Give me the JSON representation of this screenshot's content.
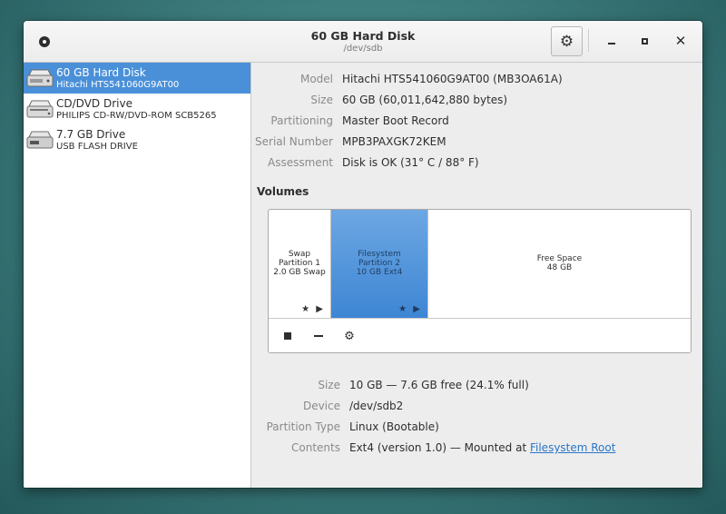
{
  "window": {
    "title": "60 GB Hard Disk",
    "subtitle": "/dev/sdb"
  },
  "titlebar_icons": {
    "menu": "app-menu-icon",
    "settings": "gear-icon",
    "minimize": "minimize-icon",
    "maximize": "maximize-icon",
    "close": "close-icon"
  },
  "sidebar": {
    "drives": [
      {
        "name": "60 GB Hard Disk",
        "detail": "Hitachi HTS541060G9AT00",
        "icon": "hard-disk-icon",
        "selected": true
      },
      {
        "name": "CD/DVD Drive",
        "detail": "PHILIPS CD-RW/DVD-ROM SCB5265",
        "icon": "optical-drive-icon",
        "selected": false
      },
      {
        "name": "7.7 GB Drive",
        "detail": "USB FLASH DRIVE",
        "icon": "usb-drive-icon",
        "selected": false
      }
    ]
  },
  "disk_properties": [
    {
      "label": "Model",
      "value": "Hitachi HTS541060G9AT00 (MB3OA61A)"
    },
    {
      "label": "Size",
      "value": "60 GB (60,011,642,880 bytes)"
    },
    {
      "label": "Partitioning",
      "value": "Master Boot Record"
    },
    {
      "label": "Serial Number",
      "value": "MPB3PAXGK72KEM"
    },
    {
      "label": "Assessment",
      "value": "Disk is OK (31° C / 88° F)"
    }
  ],
  "volumes": {
    "heading": "Volumes",
    "partitions": [
      {
        "line1": "Swap",
        "line2": "Partition 1",
        "line3": "2.0 GB Swap",
        "selected": false
      },
      {
        "line1": "Filesystem",
        "line2": "Partition 2",
        "line3": "10 GB Ext4",
        "selected": true
      },
      {
        "line1": "Free Space",
        "line2": "48 GB",
        "selected": false
      }
    ],
    "toolbar": {
      "stop": "stop-icon",
      "delete": "minus-icon",
      "more": "gears-icon"
    }
  },
  "partition_properties": [
    {
      "label": "Size",
      "value": "10 GB — 7.6 GB free (24.1% full)"
    },
    {
      "label": "Device",
      "value": "/dev/sdb2"
    },
    {
      "label": "Partition Type",
      "value": "Linux (Bootable)"
    },
    {
      "label": "Contents",
      "value": "Ext4 (version 1.0) — Mounted at ",
      "link": "Filesystem Root"
    }
  ],
  "colors": {
    "selection": "#4a90d9",
    "link": "#2a76c6"
  }
}
